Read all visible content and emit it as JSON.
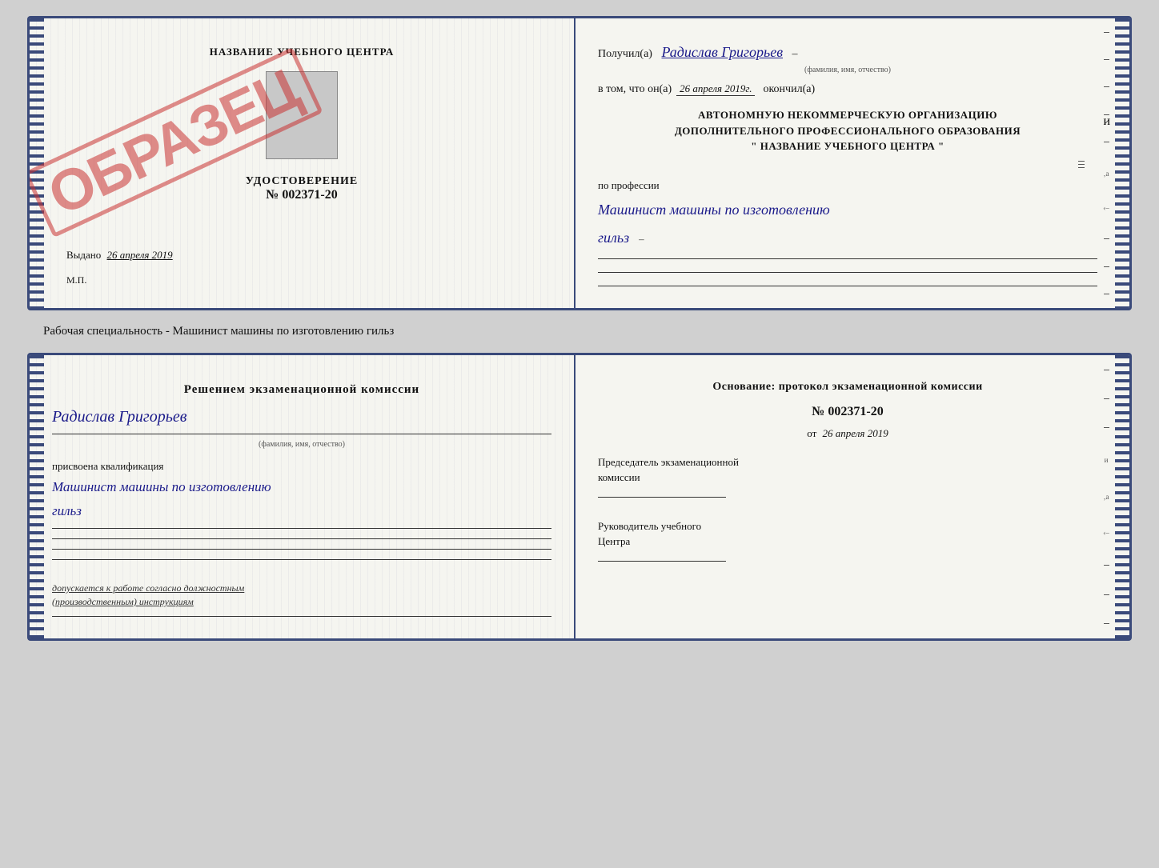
{
  "top_card": {
    "left": {
      "cert_title": "НАЗВАНИЕ УЧЕБНОГО ЦЕНТРА",
      "stamp": "ОБРАЗЕЦ",
      "cert_section_label": "УДОСТОВЕРЕНИЕ",
      "cert_number": "№ 002371-20",
      "issue_label": "Выдано",
      "issue_date": "26 апреля 2019",
      "mp_label": "М.П."
    },
    "right": {
      "received_label": "Получил(а)",
      "received_name": "Радислав Григорьев",
      "name_sub": "(фамилия, имя, отчество)",
      "date_prefix": "в том, что он(а)",
      "date_value": "26 апреля 2019г.",
      "date_suffix": "окончил(а)",
      "org_line1": "АВТОНОМНУЮ НЕКОММЕРЧЕСКУЮ ОРГАНИЗАЦИЮ",
      "org_line2": "ДОПОЛНИТЕЛЬНОГО ПРОФЕССИОНАЛЬНОГО ОБРАЗОВАНИЯ",
      "org_line3": "\"  НАЗВАНИЕ УЧЕБНОГО ЦЕНТРА  \"",
      "profession_label": "по профессии",
      "profession_value1": "Машинист машины по изготовлению",
      "profession_value2": "гильз"
    }
  },
  "caption": "Рабочая специальность - Машинист машины по изготовлению гильз",
  "bottom_card": {
    "left": {
      "commission_title": "Решением  экзаменационной  комиссии",
      "sign_name": "Радислав Григорьев",
      "sign_sub": "(фамилия, имя, отчество)",
      "qualification_label": "присвоена квалификация",
      "qualification_value1": "Машинист машины по изготовлению",
      "qualification_value2": "гильз",
      "admit_text": "допускается к  работе согласно должностным\n(производственным) инструкциям"
    },
    "right": {
      "basis_title": "Основание: протокол экзаменационной  комиссии",
      "protocol_number": "№  002371-20",
      "from_date_prefix": "от",
      "from_date_value": "26 апреля 2019",
      "chairman_label": "Председатель экзаменационной\nкомиссии",
      "head_label": "Руководитель учебного\nЦентра"
    }
  }
}
